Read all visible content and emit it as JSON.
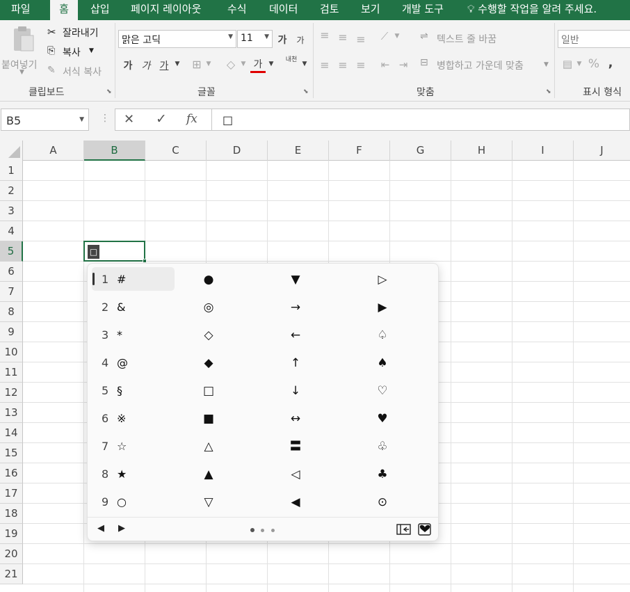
{
  "ribbon": {
    "tabs": [
      "파일",
      "홈",
      "삽입",
      "페이지 레이아웃",
      "수식",
      "데이터",
      "검토",
      "보기",
      "개발 도구"
    ],
    "active_tab": "홈",
    "tell_me": "수행할 작업을 알려 주세요.",
    "clipboard": {
      "paste": "붙여넣기",
      "cut": "잘라내기",
      "copy": "복사",
      "format_painter": "서식 복사",
      "label": "클립보드"
    },
    "font": {
      "name": "맑은 고딕",
      "size": "11",
      "grow": "가",
      "shrink": "가",
      "bold": "가",
      "italic": "가",
      "underline": "가",
      "font_color": "가",
      "phonetic": "내천",
      "label": "글꼴"
    },
    "alignment": {
      "wrap_text": "텍스트 줄 바꿈",
      "merge_center": "병합하고 가운데 맞춤",
      "label": "맞춤"
    },
    "number": {
      "format": "일반",
      "percent": "%",
      "comma": ",",
      "label": "표시 형식"
    }
  },
  "formula_bar": {
    "name_box": "B5",
    "cancel": "✕",
    "enter": "✓",
    "fx": "fx",
    "value": "□"
  },
  "grid": {
    "columns": [
      "A",
      "B",
      "C",
      "D",
      "E",
      "F",
      "G",
      "H",
      "I",
      "J"
    ],
    "rows": [
      "1",
      "2",
      "3",
      "4",
      "5",
      "6",
      "7",
      "8",
      "9",
      "10",
      "11",
      "12",
      "13",
      "14",
      "15",
      "16",
      "17",
      "18",
      "19",
      "20",
      "21"
    ],
    "selected_column": "B",
    "selected_row": "5",
    "active_cell_value": "□"
  },
  "symbol_panel": {
    "numbered": [
      {
        "num": "1",
        "ch": "#"
      },
      {
        "num": "2",
        "ch": "&"
      },
      {
        "num": "3",
        "ch": "*"
      },
      {
        "num": "4",
        "ch": "@"
      },
      {
        "num": "5",
        "ch": "§"
      },
      {
        "num": "6",
        "ch": "※"
      },
      {
        "num": "7",
        "ch": "☆"
      },
      {
        "num": "8",
        "ch": "★"
      },
      {
        "num": "9",
        "ch": "○"
      }
    ],
    "col2": [
      "●",
      "◎",
      "◇",
      "◆",
      "□",
      "■",
      "△",
      "▲",
      "▽"
    ],
    "col3": [
      "▼",
      "→",
      "←",
      "↑",
      "↓",
      "↔",
      "〓",
      "◁",
      "◀"
    ],
    "col4": [
      "▷",
      "▶",
      "♤",
      "♠",
      "♡",
      "♥",
      "♧",
      "♣",
      "⊙"
    ],
    "footer": {
      "prev": "◀",
      "next": "▶",
      "page_count": 3,
      "current_page": 1,
      "view_all_icon": "expand-panel-icon",
      "favorites_icon": "heart-icon"
    }
  }
}
